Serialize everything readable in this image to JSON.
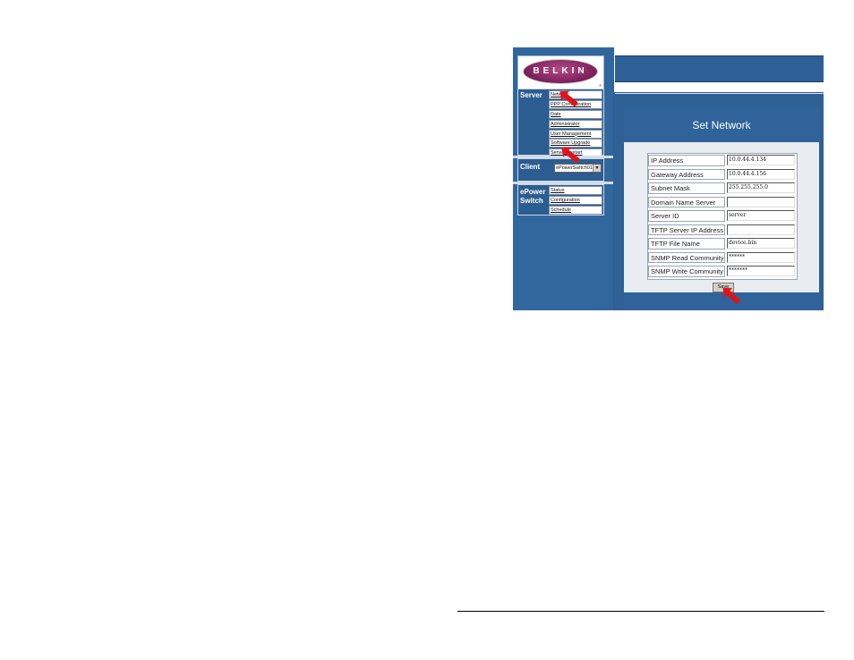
{
  "logo": {
    "text": "BELKIN",
    "trademark": "®"
  },
  "sidebar": {
    "server": {
      "label": "Server",
      "links": [
        "Network",
        "PPP Configuration",
        "Date",
        "Administrator",
        "User Management",
        "Software Upgrade",
        "Server Restart"
      ]
    },
    "client": {
      "label": "Client",
      "selected": "ePowerSwitch01"
    },
    "epower": {
      "label_line1": "ePower",
      "label_line2": "Switch",
      "links": [
        "Status",
        "Configuration",
        "Schedule"
      ]
    }
  },
  "form": {
    "title": "Set Network",
    "fields": [
      {
        "label": "IP Address",
        "value": "10.0.44.4.134"
      },
      {
        "label": "Gateway Address",
        "value": "10.0.44.4.156"
      },
      {
        "label": "Subnet Mask",
        "value": "255.255.255.0"
      },
      {
        "label": "Domain Name Server",
        "value": ""
      },
      {
        "label": "Server ID",
        "value": "server"
      },
      {
        "label": "TFTP Server IP Address",
        "value": ""
      },
      {
        "label": "TFTP File Name",
        "value": "device.bin"
      },
      {
        "label": "SNMP Read Community",
        "value": "******"
      },
      {
        "label": "SNMP Write Community",
        "value": "*******"
      }
    ],
    "save_label": "Save"
  },
  "colors": {
    "sidebar_blue": "#32679e",
    "panel_header": "#2f6399",
    "callout_arrow": "#e0131b",
    "logo_purple": "#7a1f58"
  }
}
